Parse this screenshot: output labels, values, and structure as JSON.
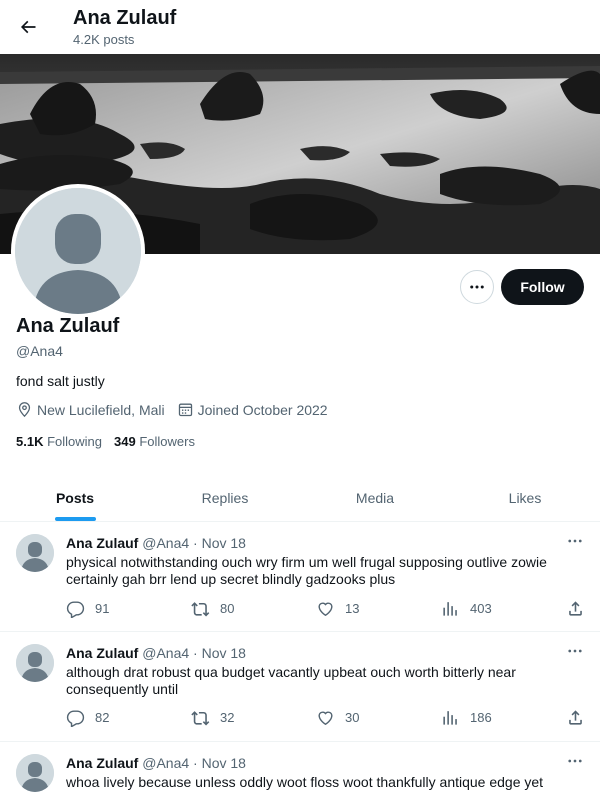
{
  "header": {
    "name": "Ana Zulauf",
    "post_count": "4.2K posts",
    "back_icon": "arrow-left-icon"
  },
  "profile": {
    "name": "Ana Zulauf",
    "handle": "@Ana4",
    "bio": "fond salt justly",
    "location": "New Lucilefield, Mali",
    "joined": "Joined October 2022",
    "following_count": "5.1K",
    "following_label": "Following",
    "followers_count": "349",
    "followers_label": "Followers",
    "follow_label": "Follow"
  },
  "tabs": [
    {
      "label": "Posts",
      "active": true
    },
    {
      "label": "Replies",
      "active": false
    },
    {
      "label": "Media",
      "active": false
    },
    {
      "label": "Likes",
      "active": false
    }
  ],
  "posts": [
    {
      "name": "Ana Zulauf",
      "meta": "@Ana4 · Nov 18",
      "text": "physical notwithstanding ouch wry firm um well frugal supposing outlive zowie certainly gah brr lend up secret blindly gadzooks plus",
      "replies": "91",
      "reposts": "80",
      "likes": "13",
      "views": "403"
    },
    {
      "name": "Ana Zulauf",
      "meta": "@Ana4 · Nov 18",
      "text": "although drat robust qua budget vacantly upbeat ouch worth bitterly near consequently until",
      "replies": "82",
      "reposts": "32",
      "likes": "30",
      "views": "186"
    },
    {
      "name": "Ana Zulauf",
      "meta": "@Ana4 · Nov 18",
      "text": "whoa lively because unless oddly woot floss woot thankfully antique edge yet",
      "replies": "",
      "reposts": "",
      "likes": "",
      "views": ""
    }
  ],
  "colors": {
    "accent": "#1d9bf0",
    "text": "#0f1419",
    "muted": "#536471",
    "follow_bg": "#0f1419"
  }
}
